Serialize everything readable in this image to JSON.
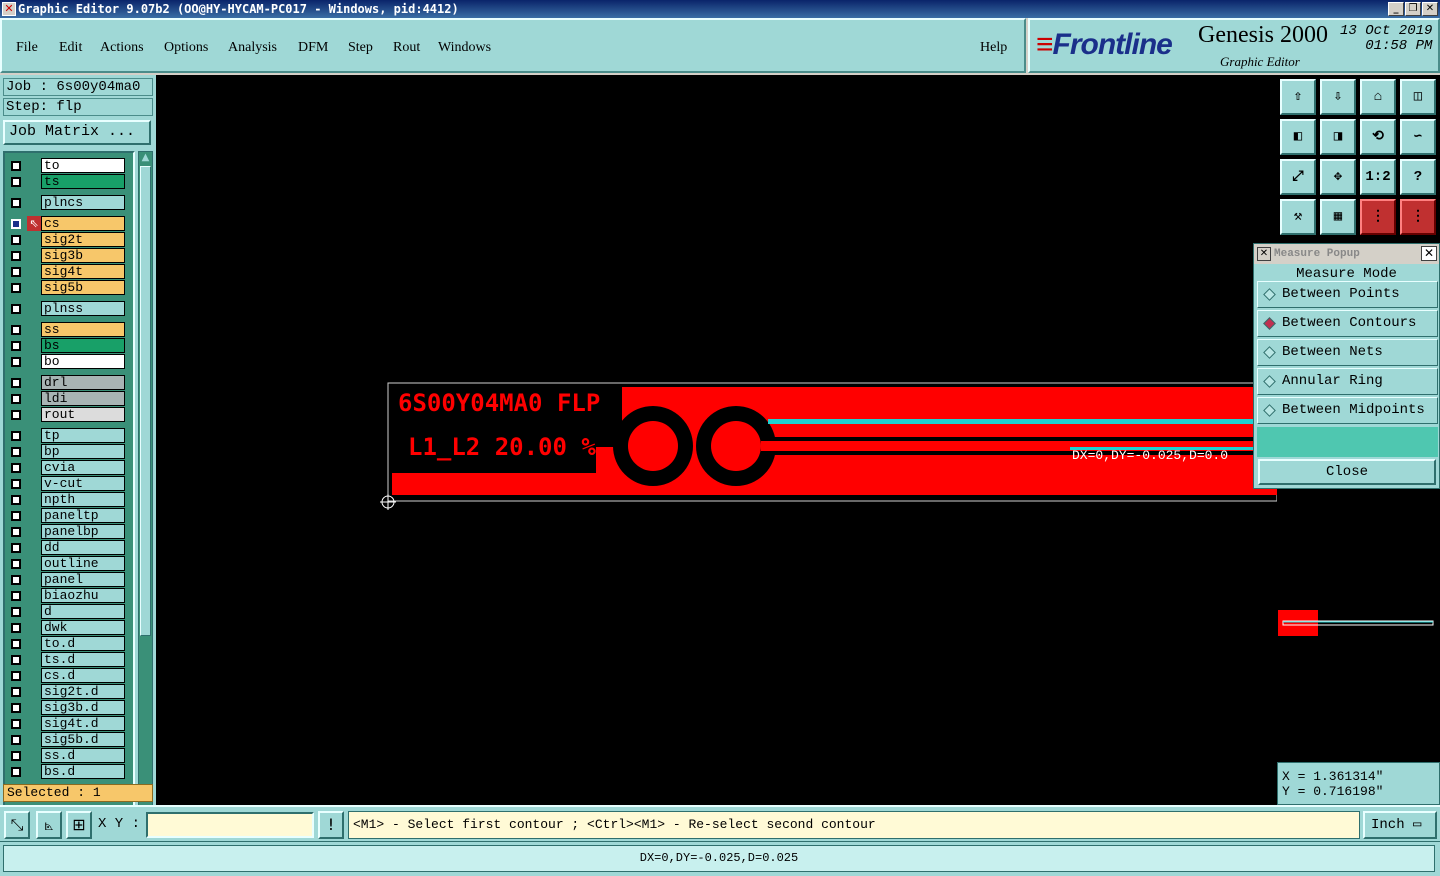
{
  "window": {
    "title": "Graphic Editor 9.07b2 (OO@HY-HYCAM-PC017 - Windows, pid:4412)"
  },
  "menu": [
    "File",
    "Edit",
    "Actions",
    "Options",
    "Analysis",
    "DFM",
    "Step",
    "Rout",
    "Windows"
  ],
  "help": "Help",
  "brand": {
    "logo": "Frontline",
    "product": "Genesis 2000",
    "subtitle": "Graphic Editor",
    "date": "13 Oct 2019",
    "time": "01:58 PM"
  },
  "job": {
    "job_label": "Job : 6s00y04ma0",
    "step_label": "Step: flp",
    "job_matrix": "Job Matrix ..."
  },
  "layers": [
    {
      "name": "to",
      "color": "#ffffff"
    },
    {
      "name": "ts",
      "color": "#18a068"
    },
    {
      "name": "plncs",
      "color": "#9fd8d6"
    },
    {
      "name": "cs",
      "color": "#f7c76a",
      "active": true
    },
    {
      "name": "sig2t",
      "color": "#f7c76a"
    },
    {
      "name": "sig3b",
      "color": "#f7c76a"
    },
    {
      "name": "sig4t",
      "color": "#f7c76a"
    },
    {
      "name": "sig5b",
      "color": "#f7c76a"
    },
    {
      "name": "plnss",
      "color": "#9fd8d6"
    },
    {
      "name": "ss",
      "color": "#f7c76a"
    },
    {
      "name": "bs",
      "color": "#18a068"
    },
    {
      "name": "bo",
      "color": "#ffffff"
    },
    {
      "name": "drl",
      "color": "#a8b4b4"
    },
    {
      "name": "ldi",
      "color": "#a8b4b4"
    },
    {
      "name": "rout",
      "color": "#dcdcdc"
    },
    {
      "name": "tp",
      "color": "#9fd8d6"
    },
    {
      "name": "bp",
      "color": "#9fd8d6"
    },
    {
      "name": "cvia",
      "color": "#9fd8d6"
    },
    {
      "name": "v-cut",
      "color": "#9fd8d6"
    },
    {
      "name": "npth",
      "color": "#9fd8d6"
    },
    {
      "name": "paneltp",
      "color": "#9fd8d6"
    },
    {
      "name": "panelbp",
      "color": "#9fd8d6"
    },
    {
      "name": "dd",
      "color": "#9fd8d6"
    },
    {
      "name": "outline",
      "color": "#9fd8d6"
    },
    {
      "name": "panel",
      "color": "#9fd8d6"
    },
    {
      "name": "biaozhu",
      "color": "#9fd8d6"
    },
    {
      "name": "d",
      "color": "#9fd8d6"
    },
    {
      "name": "dwk",
      "color": "#9fd8d6"
    },
    {
      "name": "to.d",
      "color": "#9fd8d6"
    },
    {
      "name": "ts.d",
      "color": "#9fd8d6"
    },
    {
      "name": "cs.d",
      "color": "#9fd8d6"
    },
    {
      "name": "sig2t.d",
      "color": "#9fd8d6"
    },
    {
      "name": "sig3b.d",
      "color": "#9fd8d6"
    },
    {
      "name": "sig4t.d",
      "color": "#9fd8d6"
    },
    {
      "name": "sig5b.d",
      "color": "#9fd8d6"
    },
    {
      "name": "ss.d",
      "color": "#9fd8d6"
    },
    {
      "name": "bs.d",
      "color": "#9fd8d6"
    }
  ],
  "selected": "Selected : 1",
  "canvas": {
    "text1": "6S00Y04MA0 FLP",
    "text2": "L1_L2 20.00 %",
    "measure_label": "DX=0,DY=-0.025,D=0.0"
  },
  "measure_popup": {
    "title": "Measure Popup",
    "header": "Measure Mode",
    "options": [
      {
        "label": "Between Points",
        "selected": false
      },
      {
        "label": "Between Contours",
        "selected": true
      },
      {
        "label": "Between Nets",
        "selected": false
      },
      {
        "label": "Annular Ring",
        "selected": false
      },
      {
        "label": "Between Midpoints",
        "selected": false
      }
    ],
    "close": "Close"
  },
  "coords": {
    "x": "X = 1.361314\"",
    "y": "Y = 0.716198\""
  },
  "toolbar_buttons": [
    "home-up",
    "home-down",
    "home",
    "window-grid",
    "left",
    "right",
    "undo-zoom",
    "snake",
    "fit",
    "center",
    "1:2",
    "help",
    "tools",
    "grid",
    "red-layers-1",
    "red-layers-2"
  ],
  "xy_label": "X Y :",
  "hint": "<M1> - Select first contour ; <Ctrl><M1> - Re-select second contour",
  "unit": "Inch",
  "status": "DX=0,DY=-0.025,D=0.025"
}
